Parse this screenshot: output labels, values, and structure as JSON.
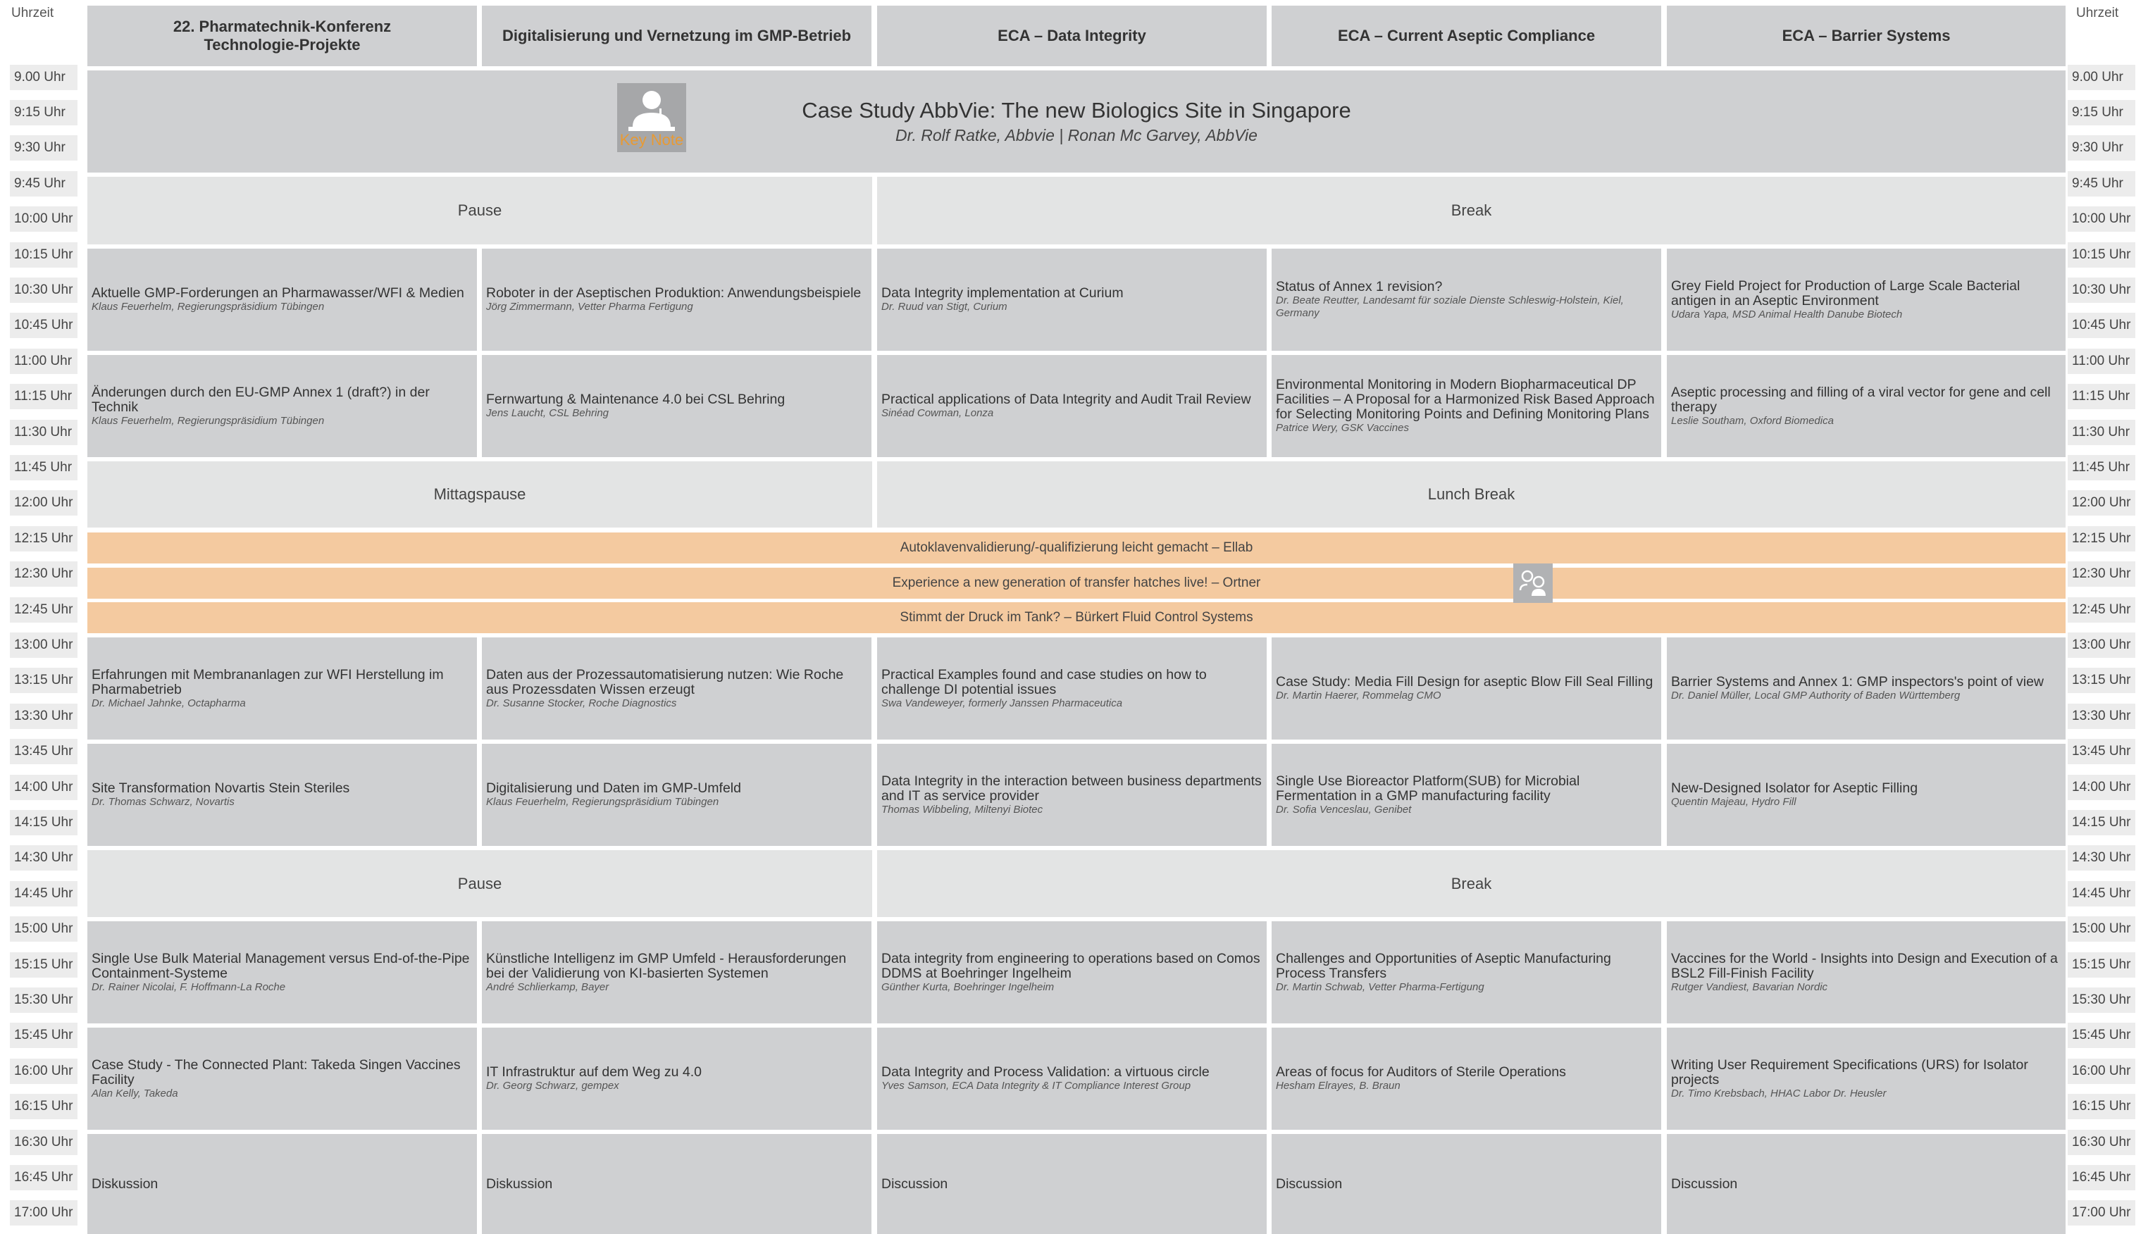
{
  "time_column_header": "Uhrzeit",
  "times": [
    "9.00 Uhr",
    "9:15 Uhr",
    "9:30 Uhr",
    "9:45 Uhr",
    "10:00 Uhr",
    "10:15 Uhr",
    "10:30 Uhr",
    "10:45 Uhr",
    "11:00 Uhr",
    "11:15 Uhr",
    "11:30 Uhr",
    "11:45 Uhr",
    "12:00 Uhr",
    "12:15 Uhr",
    "12:30 Uhr",
    "12:45 Uhr",
    "13:00 Uhr",
    "13:15 Uhr",
    "13:30 Uhr",
    "13:45 Uhr",
    "14:00 Uhr",
    "14:15 Uhr",
    "14:30 Uhr",
    "14:45 Uhr",
    "15:00 Uhr",
    "15:15 Uhr",
    "15:30 Uhr",
    "15:45 Uhr",
    "16:00 Uhr",
    "16:15 Uhr",
    "16:30 Uhr",
    "16:45 Uhr",
    "17:00 Uhr"
  ],
  "tracks": [
    {
      "line1": "22. Pharmatechnik-Konferenz",
      "line2": "Technologie-Projekte"
    },
    {
      "line1": "Digitalisierung und Vernetzung im GMP-Betrieb",
      "line2": ""
    },
    {
      "line1": "ECA – Data Integrity",
      "line2": ""
    },
    {
      "line1": "ECA – Current Aseptic Compliance",
      "line2": ""
    },
    {
      "line1": "ECA – Barrier Systems",
      "line2": ""
    }
  ],
  "keynote": {
    "label": "Key Note",
    "title": "Case Study AbbVie: The new Biologics Site in Singapore",
    "speakers": "Dr. Rolf Ratke, Abbvie  |  Ronan Mc Garvey, AbbVie"
  },
  "breaks": {
    "pause_de": "Pause",
    "pause_en": "Break",
    "lunch_de": "Mittagspause",
    "lunch_en": "Lunch Break",
    "pause2_de": "Pause",
    "pause2_en": "Break"
  },
  "session1": [
    {
      "title": "Aktuelle GMP-Forderungen an Pharmawasser/WFI & Medien",
      "speaker": "Klaus Feuerhelm, Regierungspräsidium Tübingen"
    },
    {
      "title": "Roboter in der Aseptischen Produktion: Anwendungsbeispiele",
      "speaker": "Jörg Zimmermann, Vetter Pharma Fertigung"
    },
    {
      "title": "Data Integrity implementation at Curium",
      "speaker": "Dr. Ruud van Stigt, Curium"
    },
    {
      "title": "Status of Annex 1 revision?",
      "speaker": "Dr. Beate Reutter, Landesamt für soziale Dienste Schleswig-Holstein, Kiel, Germany"
    },
    {
      "title": "Grey Field Project for Production of Large Scale Bacterial antigen in an Aseptic Environment",
      "speaker": "Udara Yapa, MSD Animal Health Danube Biotech"
    }
  ],
  "session2": [
    {
      "title": "Änderungen durch den EU-GMP Annex 1 (draft?) in der Technik",
      "speaker": "Klaus Feuerhelm, Regierungspräsidium Tübingen"
    },
    {
      "title": "Fernwartung & Maintenance 4.0 bei CSL Behring",
      "speaker": "Jens Laucht, CSL Behring"
    },
    {
      "title": "Practical applications of Data Integrity and Audit Trail Review",
      "speaker": "Sinéad Cowman, Lonza"
    },
    {
      "title": "Environmental Monitoring in Modern Biopharmaceutical DP Facilities – A Proposal for a Harmonized Risk Based Approach for Selecting Monitoring Points and Defining Monitoring Plans",
      "speaker": "Patrice Wery, GSK Vaccines"
    },
    {
      "title": "Aseptic processing and filling of a viral vector for gene and cell therapy",
      "speaker": "Leslie Southam, Oxford Biomedica"
    }
  ],
  "lunch_talks": [
    "Autoklavenvalidierung/-qualifizierung leicht gemacht – Ellab",
    "Experience a new generation of transfer hatches live! – Ortner",
    "Stimmt der Druck im Tank? – Bürkert Fluid Control Systems"
  ],
  "session3": [
    {
      "title": "Erfahrungen mit Membrananlagen zur WFI Herstellung im Pharmabetrieb",
      "speaker": "Dr. Michael Jahnke, Octapharma"
    },
    {
      "title": "Daten aus der Prozessautomatisierung nutzen: Wie Roche aus Prozessdaten Wissen erzeugt",
      "speaker": "Dr. Susanne Stocker, Roche Diagnostics"
    },
    {
      "title": "Practical Examples found and case studies on how to challenge DI potential issues",
      "speaker": "Swa Vandeweyer, formerly Janssen Pharmaceutica"
    },
    {
      "title": "Case Study: Media Fill Design for aseptic Blow Fill Seal Filling",
      "speaker": "Dr. Martin Haerer, Rommelag CMO"
    },
    {
      "title": "Barrier Systems and Annex 1:  GMP inspectors's point of view",
      "speaker": "Dr. Daniel Müller, Local GMP Authority of Baden Württemberg"
    }
  ],
  "session4": [
    {
      "title": "Site Transformation Novartis Stein Steriles",
      "speaker": "Dr. Thomas Schwarz, Novartis"
    },
    {
      "title": "Digitalisierung und Daten im GMP-Umfeld",
      "speaker": "Klaus Feuerhelm, Regierungspräsidium Tübingen"
    },
    {
      "title": "Data Integrity in the interaction between business departments and IT as service provider",
      "speaker": "Thomas Wibbeling, Miltenyi Biotec"
    },
    {
      "title": "Single Use Bioreactor Platform(SUB)  for Microbial Fermentation in a GMP manufacturing facility",
      "speaker": "Dr. Sofia Venceslau, Genibet"
    },
    {
      "title": "New-Designed Isolator for Aseptic Filling",
      "speaker": "Quentin Majeau, Hydro Fill"
    }
  ],
  "session5": [
    {
      "title": "Single Use Bulk Material Management versus End-of-the-Pipe Containment-Systeme",
      "speaker": "Dr. Rainer Nicolai, F. Hoffmann-La Roche"
    },
    {
      "title": "Künstliche Intelligenz im GMP Umfeld - Herausforderungen bei der Validierung von KI-basierten Systemen",
      "speaker": "André Schlierkamp, Bayer"
    },
    {
      "title": "Data integrity from engineering to operations based on Comos DDMS at Boehringer Ingelheim",
      "speaker": "Günther Kurta, Boehringer Ingelheim"
    },
    {
      "title": "Challenges and Opportunities of Aseptic Manufacturing Process Transfers",
      "speaker": "Dr. Martin Schwab, Vetter Pharma-Fertigung"
    },
    {
      "title": "Vaccines for the World - Insights into Design and Execution of a BSL2 Fill-Finish Facility",
      "speaker": "Rutger Vandiest, Bavarian Nordic"
    }
  ],
  "session6": [
    {
      "title": "Case Study - The Connected Plant: Takeda Singen Vaccines Facility",
      "speaker": "Alan Kelly, Takeda"
    },
    {
      "title": "IT Infrastruktur auf dem Weg zu 4.0",
      "speaker": "Dr. Georg Schwarz, gempex"
    },
    {
      "title": "Data Integrity and Process Validation: a virtuous circle",
      "speaker": "Yves Samson, ECA Data Integrity & IT Compliance Interest Group"
    },
    {
      "title": "Areas of focus for Auditors of Sterile Operations",
      "speaker": "Hesham Elrayes, B. Braun"
    },
    {
      "title": "Writing User Requirement Specifications (URS) for Isolator projects",
      "speaker": "Dr. Timo Krebsbach, HHAC Labor Dr. Heusler"
    }
  ],
  "discussion": [
    "Diskussion",
    "Diskussion",
    "Discussion",
    "Discussion",
    "Discussion"
  ]
}
